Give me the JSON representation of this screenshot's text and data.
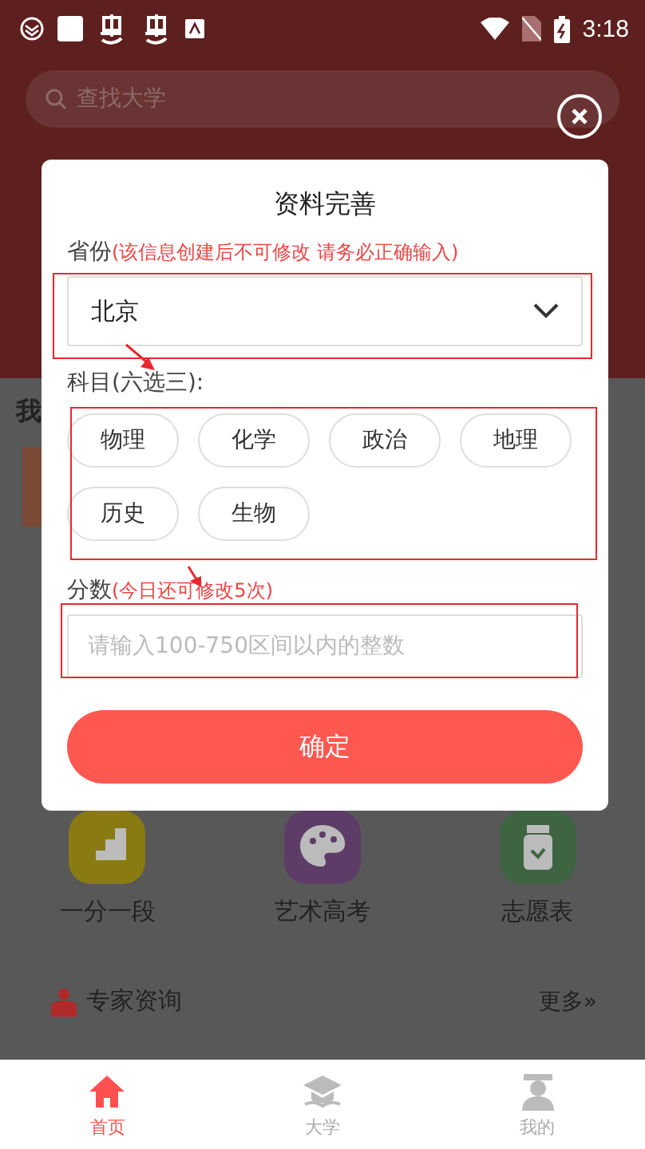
{
  "status_bar": {
    "time": "3:18"
  },
  "search": {
    "placeholder": "查找大学"
  },
  "background": {
    "section_title": "我",
    "tools": [
      {
        "label": "一分一段",
        "kind": "steps",
        "color": "#8a7a12"
      },
      {
        "label": "艺术高考",
        "kind": "palette",
        "color": "#5e3c68"
      },
      {
        "label": "志愿表",
        "kind": "jar",
        "color": "#3f6442"
      }
    ],
    "expert": {
      "title": "专家资询",
      "more": "更多»"
    }
  },
  "dialog": {
    "title": "资料完善",
    "province": {
      "label": "省份",
      "hint": "(该信息创建后不可修改 请务必正确输入)",
      "value": "北京"
    },
    "subjects": {
      "label": "科目(六选三):",
      "items": [
        {
          "label": "物理",
          "selected": false
        },
        {
          "label": "化学",
          "selected": false
        },
        {
          "label": "政治",
          "selected": false
        },
        {
          "label": "地理",
          "selected": false
        },
        {
          "label": "历史",
          "selected": false
        },
        {
          "label": "生物",
          "selected": false
        }
      ]
    },
    "score": {
      "label": "分数",
      "hint": "(今日还可修改5次)",
      "placeholder": "请输入100-750区间以内的整数"
    },
    "confirm": "确定"
  },
  "tabs": [
    {
      "label": "首页",
      "kind": "home",
      "selected": true
    },
    {
      "label": "大学",
      "kind": "cap",
      "selected": false
    },
    {
      "label": "我的",
      "kind": "person",
      "selected": false
    }
  ]
}
